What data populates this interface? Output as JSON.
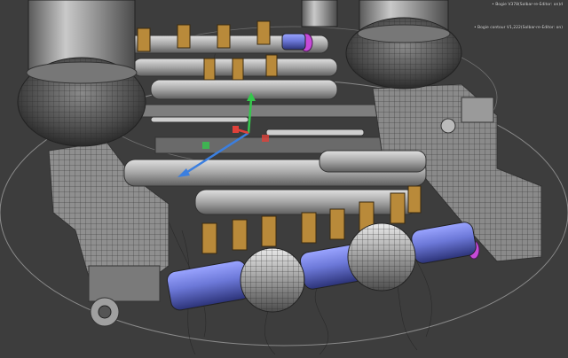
{
  "viewport": {
    "background": "#3d3d3d",
    "labels": [
      "• Bogie V378(Solbar-re-Editor: on)d",
      "• Bogie contour V1,222(Solbar-re-Editor: on)"
    ]
  },
  "colors": {
    "metal": "#b9b9b9",
    "metal_dark": "#6f6f6f",
    "bronze": "#b98a3a",
    "axle_blue": "#6c78d8",
    "highlight_magenta": "#c64ad8",
    "gizmo_x": "#3b7fe0",
    "gizmo_y": "#35c64c",
    "gizmo_z": "#e0413a"
  },
  "icons": [
    "transform-gizmo-icon"
  ]
}
